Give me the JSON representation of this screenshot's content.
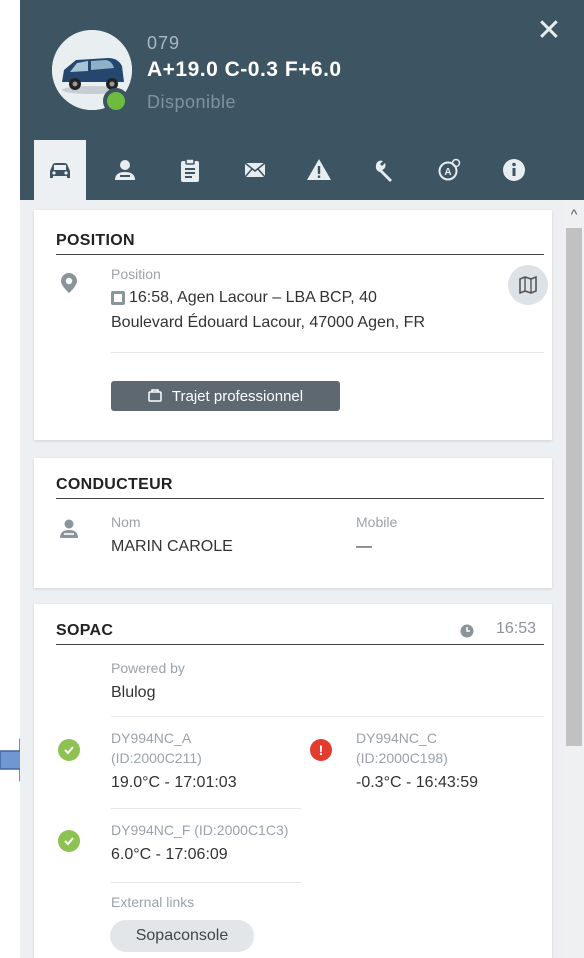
{
  "header": {
    "vehicle_id": "079",
    "temperatures": "A+19.0 C-0.3 F+6.0",
    "status": "Disponible",
    "status_color": "#6dbb3f",
    "close_symbol": "✕"
  },
  "tabs": [
    {
      "name": "vehicle",
      "icon": "car-icon",
      "active": true
    },
    {
      "name": "driver",
      "icon": "driver-icon"
    },
    {
      "name": "tasks",
      "icon": "clipboard-icon"
    },
    {
      "name": "messages",
      "icon": "envelope-icon"
    },
    {
      "name": "alerts",
      "icon": "warning-icon"
    },
    {
      "name": "maintenance",
      "icon": "wrench-icon"
    },
    {
      "name": "tachograph",
      "icon": "tachograph-icon"
    },
    {
      "name": "info",
      "icon": "info-icon"
    }
  ],
  "position": {
    "title": "POSITION",
    "label": "Position",
    "time_place": "16:58, Agen Lacour – LBA BCP, 40",
    "address": "Boulevard Édouard Lacour, 47000 Agen, FR",
    "trip_button": "Trajet professionnel"
  },
  "driver": {
    "title": "CONDUCTEUR",
    "name_label": "Nom",
    "name": "MARIN CAROLE",
    "mobile_label": "Mobile",
    "mobile": "—"
  },
  "sopac": {
    "title": "SOPAC",
    "time": "16:53",
    "powered_label": "Powered by",
    "powered_value": "Blulog",
    "sensors": [
      {
        "id": "DY994NC_A",
        "sub": "(ID:2000C211)",
        "reading": "19.0°C - 17:01:03",
        "status": "ok"
      },
      {
        "id": "DY994NC_C",
        "sub": "(ID:2000C198)",
        "reading": "-0.3°C - 16:43:59",
        "status": "error"
      },
      {
        "id": "DY994NC_F (ID:2000C1C3)",
        "reading": "6.0°C - 17:06:09",
        "status": "ok"
      }
    ],
    "links_label": "External links",
    "link": "Sopaconsole"
  },
  "colors": {
    "header_bg": "#3d5462",
    "ok": "#8dc252",
    "error": "#e33b2e",
    "arrow": "#6f97d2"
  }
}
